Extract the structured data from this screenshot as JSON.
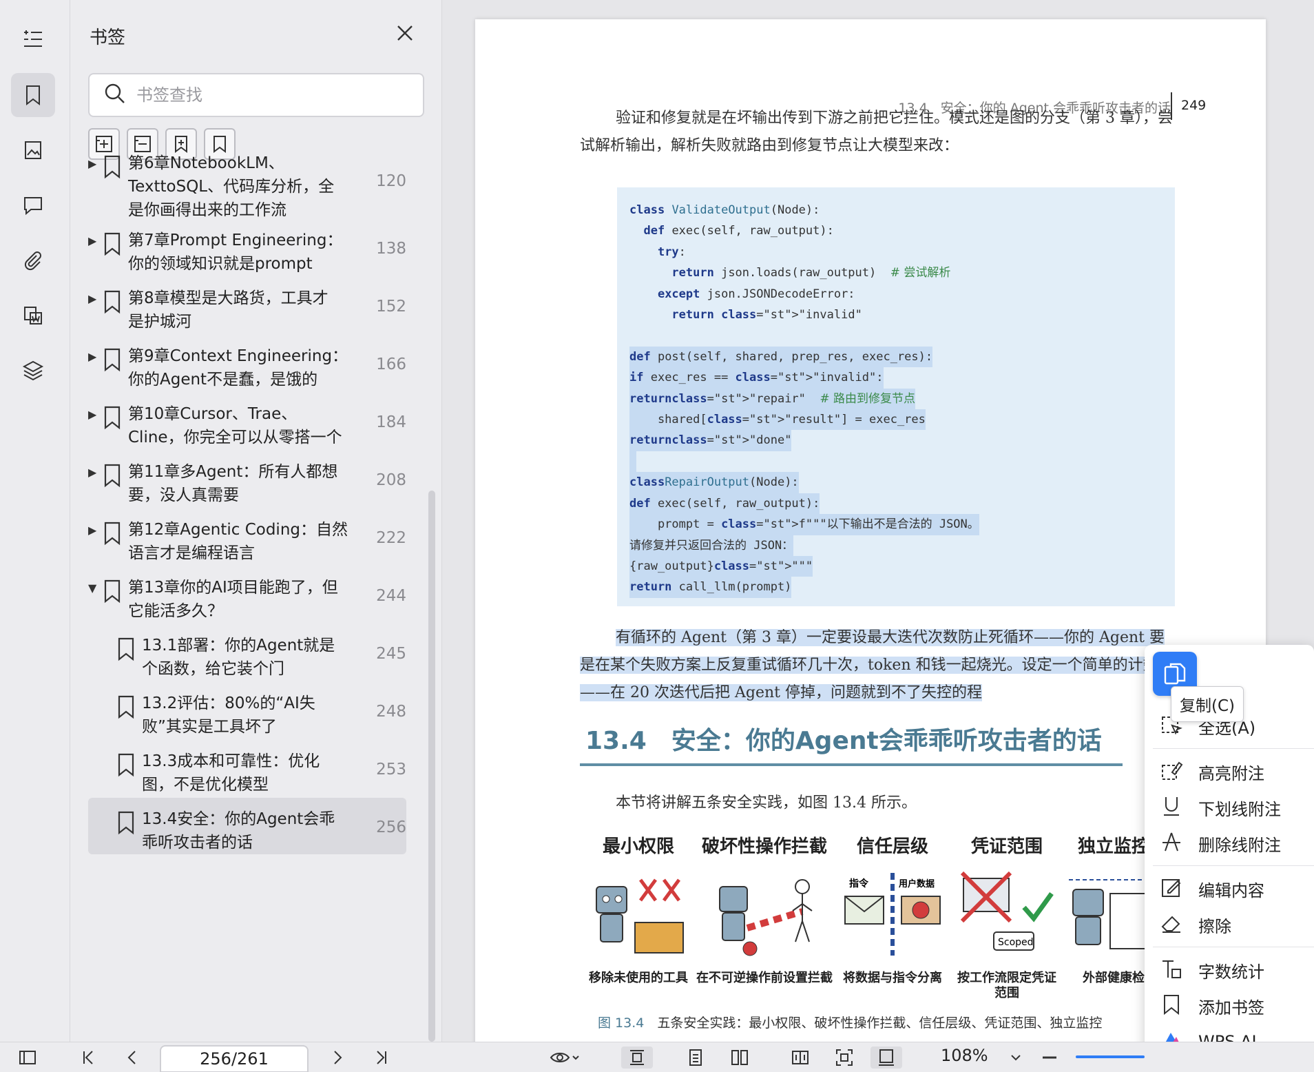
{
  "panel": {
    "title": "书签",
    "search_placeholder": "书签查找",
    "items": [
      {
        "text": "第6章NotebookLM、TexttoSQL、代码库分析，全是你画得出来的工作流",
        "lines": [
          "第6章NotebookLM、",
          "TexttoSQL、代码库分析，全",
          "是你画得出来的工作流"
        ],
        "page": "120",
        "expandable": true,
        "expanded": false
      },
      {
        "text": "第7章Prompt Engineering：你的领域知识就是prompt",
        "lines": [
          "第7章Prompt Engineering：",
          "你的领域知识就是prompt"
        ],
        "page": "138",
        "expandable": true,
        "expanded": false
      },
      {
        "text": "第8章模型是大路货，工具才是护城河",
        "lines": [
          "第8章模型是大路货，工具才",
          "是护城河"
        ],
        "page": "152",
        "expandable": true,
        "expanded": false
      },
      {
        "text": "第9章Context Engineering：你的Agent不是蠢，是饿的",
        "lines": [
          "第9章Context Engineering：",
          "你的Agent不是蠢，是饿的"
        ],
        "page": "166",
        "expandable": true,
        "expanded": false
      },
      {
        "text": "第10章Cursor、Trae、Cline，你完全可以从零搭一个",
        "lines": [
          "第10章Cursor、Trae、",
          "Cline，你完全可以从零搭一个"
        ],
        "page": "184",
        "expandable": true,
        "expanded": false
      },
      {
        "text": "第11章多Agent：所有人都想要，没人真需要",
        "lines": [
          "第11章多Agent：所有人都想",
          "要，没人真需要"
        ],
        "page": "208",
        "expandable": true,
        "expanded": false
      },
      {
        "text": "第12章Agentic Coding：自然语言才是编程语言",
        "lines": [
          "第12章Agentic Coding：自然",
          "语言才是编程语言"
        ],
        "page": "222",
        "expandable": true,
        "expanded": false
      },
      {
        "text": "第13章你的AI项目能跑了，但它能活多久？",
        "lines": [
          "第13章你的AI项目能跑了，但",
          "它能活多久？"
        ],
        "page": "244",
        "expandable": true,
        "expanded": true
      },
      {
        "text": "13.1部署：你的Agent就是个函数，给它装个门",
        "lines": [
          "13.1部署：你的Agent就是",
          "个函数，给它装个门"
        ],
        "page": "245",
        "expandable": false,
        "expanded": false
      },
      {
        "text": "13.2评估：80%的“AI失败”其实是工具坏了",
        "lines": [
          "13.2评估：80%的“AI失",
          "败”其实是工具坏了"
        ],
        "page": "248",
        "expandable": false,
        "expanded": false
      },
      {
        "text": "13.3成本和可靠性：优化图，不是优化模型",
        "lines": [
          "13.3成本和可靠性：优化",
          "图，不是优化模型"
        ],
        "page": "253",
        "expandable": false,
        "expanded": false
      },
      {
        "text": "13.4安全：你的Agent会乖乖听攻击者的话",
        "lines": [
          "13.4安全：你的Agent会乖",
          "乖听攻击者的话"
        ],
        "page": "256",
        "expandable": false,
        "expanded": false,
        "selected": true
      }
    ]
  },
  "doc": {
    "running_header": "13.4　安全：你的 Agent 会乖乖听攻击者的话",
    "page_number": "249",
    "para1": "验证和修复就是在坏输出传到下游之前把它拦住。模式还是图的分支（第 3 章），尝试解析输出，解析失败就路由到修复节点让大模型来改：",
    "para2": "有循环的 Agent（第 3 章）一定要设最大迭代次数防止死循环——你的 Agent 要是在某个失败方案上反复重试循环几十次，token 和钱一起烧光。设定一个简单的计数器——在 20 次迭代后把 Agent 停掉，问题就到不了失控的程",
    "section_title": "13.4　安全：你的Agent会乖乖听攻击者的话",
    "para3": "本节将讲解五条安全实践，如图 13.4 所示。",
    "figure": {
      "columns": [
        {
          "head": "最小权限",
          "caption": "移除未使用的工具"
        },
        {
          "head": "破坏性操作拦截",
          "caption": "在不可逆操作前设置拦截"
        },
        {
          "head": "信任层级",
          "caption": "将数据与指令分离",
          "tags": [
            "指令",
            "用户数据"
          ]
        },
        {
          "head": "凭证范围",
          "caption": "按工作流限定凭证范围",
          "tags": [
            "Scoped"
          ]
        },
        {
          "head": "独立监控",
          "caption": "外部健康检"
        }
      ],
      "caption_num": "图 13.4",
      "caption_text": "五条安全实践：最小权限、破坏性操作拦截、信任层级、凭证范围、独立监控"
    }
  },
  "code_lines": [
    "class ValidateOutput(Node):",
    "  def exec(self, raw_output):",
    "    try:",
    "      return json.loads(raw_output)  # 尝试解析",
    "    except json.JSONDecodeError:",
    "      return \"invalid\"",
    "",
    "  def post(self, shared, prep_res, exec_res):",
    "    if exec_res == \"invalid\":",
    "      return \"repair\"  # 路由到修复节点",
    "    shared[\"result\"] = exec_res",
    "    return \"done\"",
    "",
    "class RepairOutput(Node):",
    "  def exec(self, raw_output):",
    "    prompt = f\"\"\"以下输出不是合法的 JSON。",
    "请修复并只返回合法的 JSON：",
    "{raw_output}\"\"\"",
    "    return call_llm(prompt)"
  ],
  "context_menu": {
    "tooltip": "复制(C)",
    "items": [
      {
        "label": "全选(A)"
      },
      {
        "label": "高亮附注"
      },
      {
        "label": "下划线附注"
      },
      {
        "label": "删除线附注"
      },
      {
        "label": "编辑内容"
      },
      {
        "label": "擦除"
      },
      {
        "label": "字数统计"
      },
      {
        "label": "添加书签"
      },
      {
        "label": "WPS AI"
      }
    ]
  },
  "statusbar": {
    "page_indicator": "256/261",
    "zoom": "108%"
  },
  "colors": {
    "accent": "#2f7df6",
    "section_heading": "#4a7a92",
    "selection": "#cfe0f5"
  }
}
